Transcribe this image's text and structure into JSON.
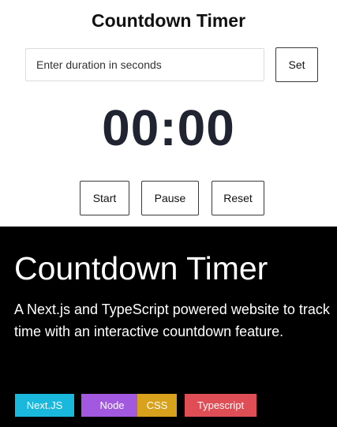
{
  "timer": {
    "title": "Countdown Timer",
    "duration_input": {
      "value": "",
      "placeholder": "Enter duration in seconds"
    },
    "set_label": "Set",
    "display": "00:00",
    "controls": {
      "start_label": "Start",
      "pause_label": "Pause",
      "reset_label": "Reset"
    }
  },
  "project_card": {
    "title": "Countdown Timer",
    "description": "A Next.js and TypeScript powered website to track time with an interactive countdown feature.",
    "tags": [
      {
        "label": "Next.JS",
        "color": "#1ab8dc"
      },
      {
        "label": "Node",
        "color": "#a259e0"
      },
      {
        "label": "CSS",
        "color": "#d8a21c"
      },
      {
        "label": "Typescript",
        "color": "#e04e55"
      }
    ]
  }
}
